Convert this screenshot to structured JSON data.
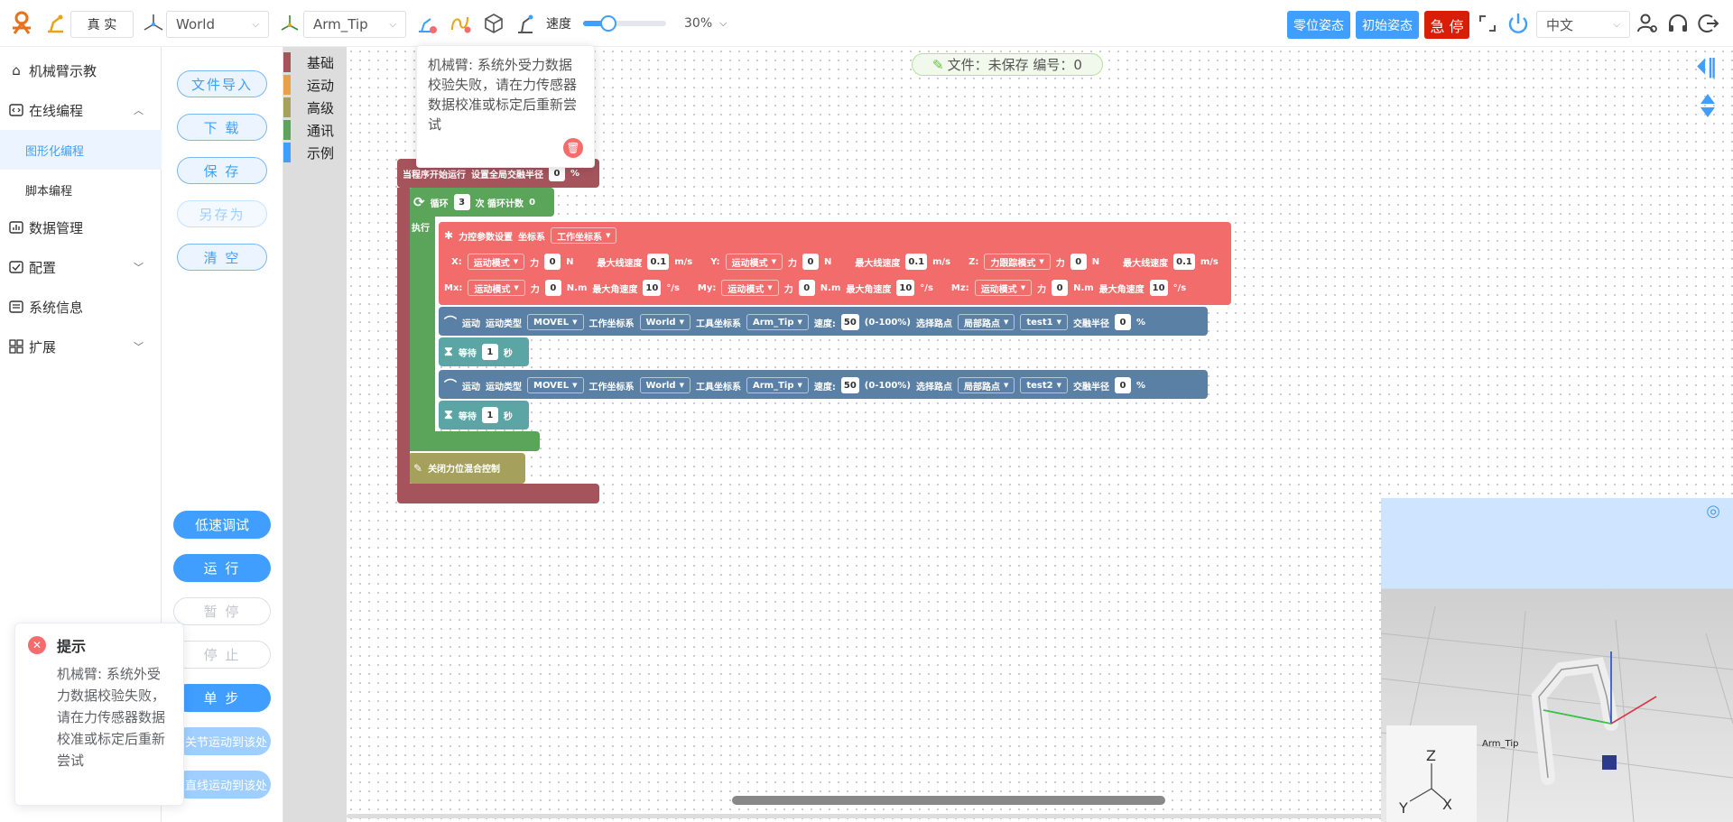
{
  "topbar": {
    "mode_button": "真 实",
    "world_select": "World",
    "tool_select": "Arm_Tip",
    "speed_label": "速度",
    "speed_value": "30%",
    "speed_fraction": 0.3,
    "zero_pose": "零位姿态",
    "init_pose": "初始姿态",
    "estop": "急 停",
    "language": "中文"
  },
  "sidebar": {
    "teach": "机械臂示教",
    "online": "在线编程",
    "graphical": "图形化编程",
    "script": "脚本编程",
    "data": "数据管理",
    "config": "配置",
    "sysinfo": "系统信息",
    "extend": "扩展"
  },
  "ctrl": {
    "import": "文件导入",
    "download": "下 载",
    "save": "保 存",
    "save_as": "另存为",
    "clear": "清 空",
    "low_speed": "低速调试",
    "run": "运 行",
    "pause": "暂 停",
    "stop": "停 止",
    "step": "单 步",
    "joint_move": "关节运动到该处",
    "linear_move": "直线运动到该处"
  },
  "toolbox": {
    "cats": [
      "基础",
      "运动",
      "高级",
      "通讯",
      "示例"
    ]
  },
  "popover": {
    "text": "机械臂: 系统外受力数据校验失败，请在力传感器数据校准或标定后重新尝试"
  },
  "file_status": "文件：未保存 编号：0",
  "notify": {
    "title": "提示",
    "text": "机械臂: 系统外受力数据校验失败，请在力传感器数据校准或标定后重新尝试"
  },
  "blocks": {
    "start_label": "当程序开始运行",
    "blend_label": "设置全局交融半径",
    "blend_value": "0",
    "percent": "%",
    "loop_label": "循环",
    "loop_count": "3",
    "loop_times": "次 循环计数",
    "loop_counter": "0",
    "exec_label": "执行",
    "force_title": "力控参数设置",
    "coord_label": "坐标系",
    "coord_value": "工作坐标系",
    "axes": [
      {
        "name": "X:",
        "mode": "运动模式",
        "force_lbl": "力",
        "force": "0",
        "unit": "N",
        "vel_lbl": "最大线速度",
        "vel": "0.1",
        "vunit": "m/s"
      },
      {
        "name": "Y:",
        "mode": "运动模式",
        "force_lbl": "力",
        "force": "0",
        "unit": "N",
        "vel_lbl": "最大线速度",
        "vel": "0.1",
        "vunit": "m/s"
      },
      {
        "name": "Z:",
        "mode": "力跟踪模式",
        "force_lbl": "力",
        "force": "0",
        "unit": "N",
        "vel_lbl": "最大线速度",
        "vel": "0.1",
        "vunit": "m/s"
      },
      {
        "name": "Mx:",
        "mode": "运动模式",
        "force_lbl": "力",
        "force": "0",
        "unit": "N.m",
        "vel_lbl": "最大角速度",
        "vel": "10",
        "vunit": "°/s"
      },
      {
        "name": "My:",
        "mode": "运动模式",
        "force_lbl": "力",
        "force": "0",
        "unit": "N.m",
        "vel_lbl": "最大角速度",
        "vel": "10",
        "vunit": "°/s"
      },
      {
        "name": "Mz:",
        "mode": "运动模式",
        "force_lbl": "力",
        "force": "0",
        "unit": "N.m",
        "vel_lbl": "最大角速度",
        "vel": "10",
        "vunit": "°/s"
      }
    ],
    "moves": [
      {
        "label": "运动",
        "type_lbl": "运动类型",
        "type": "MOVEL",
        "wc_lbl": "工作坐标系",
        "wc": "World",
        "tc_lbl": "工具坐标系",
        "tc": "Arm_Tip",
        "spd_lbl": "速度:",
        "spd": "50",
        "range": "(0-100%)",
        "pt_lbl": "选择路点",
        "pt_type": "局部路点",
        "pt": "test1",
        "blend_lbl": "交融半径",
        "blend": "0",
        "pct": "%"
      },
      {
        "label": "运动",
        "type_lbl": "运动类型",
        "type": "MOVEL",
        "wc_lbl": "工作坐标系",
        "wc": "World",
        "tc_lbl": "工具坐标系",
        "tc": "Arm_Tip",
        "spd_lbl": "速度:",
        "spd": "50",
        "range": "(0-100%)",
        "pt_lbl": "选择路点",
        "pt_type": "局部路点",
        "pt": "test2",
        "blend_lbl": "交融半径",
        "blend": "0",
        "pct": "%"
      }
    ],
    "wait_label": "等待",
    "wait_value": "1",
    "wait_unit": "秒",
    "close_force": "关闭力位混合控制"
  },
  "scene": {
    "tip_label": "Arm_Tip",
    "axis_z": "Z",
    "axis_y": "Y",
    "axis_x": "X"
  },
  "colors": {
    "primary": "#409eff",
    "estop": "#d81e06",
    "logo": "#e8711c",
    "start_block": "#a5545c",
    "loop_block": "#5ba55b",
    "force_block": "#f36c6c",
    "move_block": "#5b80a5",
    "wait_block": "#5ba5a5",
    "close_block": "#a5a05b"
  }
}
